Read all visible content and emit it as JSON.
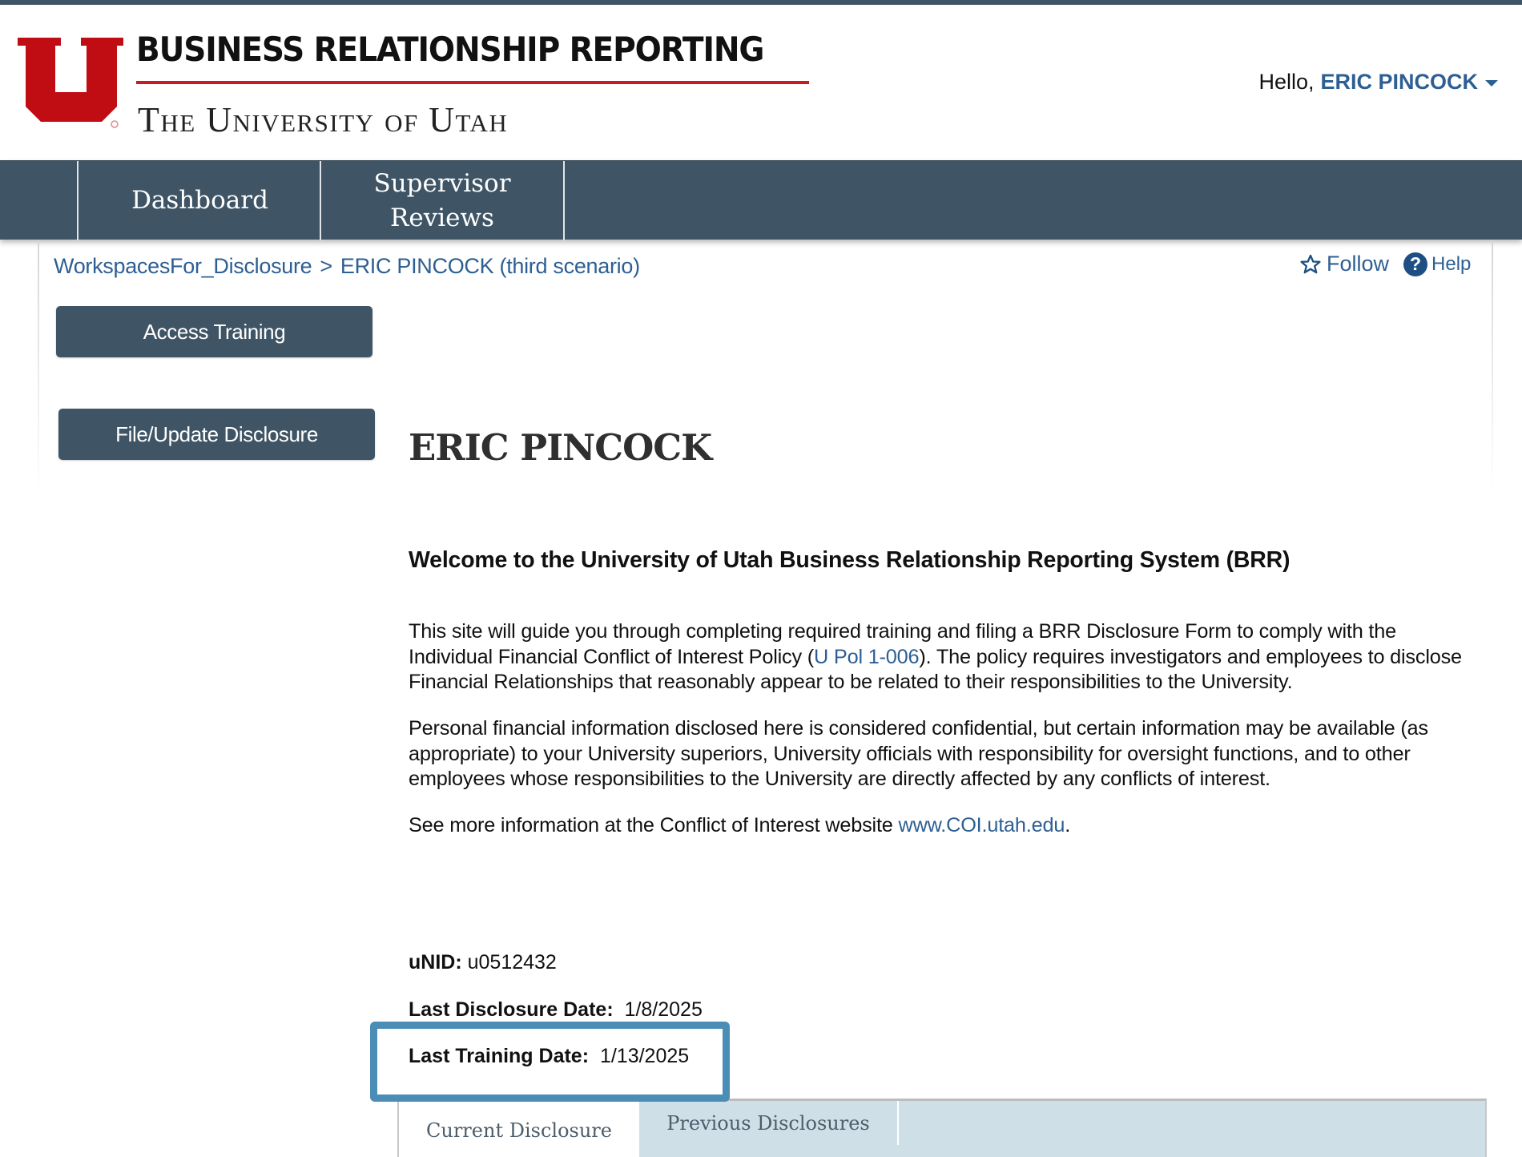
{
  "header": {
    "brand_title": "BUSINESS RELATIONSHIP REPORTING",
    "brand_subtitle": "The University of Utah",
    "logo_icon": "university-of-utah-block-u-logo",
    "greeting": "Hello,",
    "user_name": "ERIC PINCOCK",
    "user_menu_icon": "caret-down-icon",
    "brand_color": "#cc1a22"
  },
  "nav": {
    "items": [
      {
        "label": "Dashboard"
      },
      {
        "label": "Supervisor Reviews",
        "line1": "Supervisor",
        "line2": "Reviews"
      }
    ],
    "bg_color": "#3f5566"
  },
  "breadcrumb": {
    "items": [
      {
        "label": "WorkspacesFor_Disclosure"
      },
      {
        "label": "ERIC PINCOCK (third scenario)"
      }
    ],
    "separator": ">"
  },
  "actions": {
    "follow_label": "Follow",
    "follow_icon": "star-outline-icon",
    "help_label": "Help",
    "help_icon": "question-circle-icon"
  },
  "side_buttons": {
    "access_training": "Access Training",
    "file_update_disclosure": "File/Update Disclosure"
  },
  "main": {
    "title": "ERIC PINCOCK",
    "welcome_heading": "Welcome to the University of Utah Business Relationship Reporting System (BRR)",
    "para1_before": "This site will guide you through completing required training and filing a BRR Disclosure Form to comply with the Individual Financial Conflict of Interest Policy (",
    "para1_link": "U Pol 1-006",
    "para1_after": "). The policy requires investigators and employees to disclose Financial Relationships that reasonably appear to be related to their responsibilities to the University.",
    "para2": "Personal financial information disclosed here is considered confidential, but certain information may be available (as appropriate) to your University superiors, University officials with responsibility for oversight functions, and to other employees whose responsibilities to the University are directly affected by any conflicts of interest.",
    "para3_before": "See more information at the Conflict of Interest website ",
    "para3_link": "www.COI.utah.edu",
    "para3_after": ".",
    "link_color": "#2d5f93"
  },
  "fields": {
    "unid_label": "uNID:",
    "unid_value": "u0512432",
    "last_disclosure_label": "Last Disclosure Date:",
    "last_disclosure_value": "1/8/2025",
    "last_training_label": "Last Training Date:",
    "last_training_value": "1/13/2025"
  },
  "annotation": {
    "highlight_color": "#4a8db7",
    "highlights": "Last Training Date"
  },
  "tabs": [
    {
      "label": "Current Disclosure",
      "active": true
    },
    {
      "label": "Previous Disclosures",
      "active": false
    }
  ]
}
